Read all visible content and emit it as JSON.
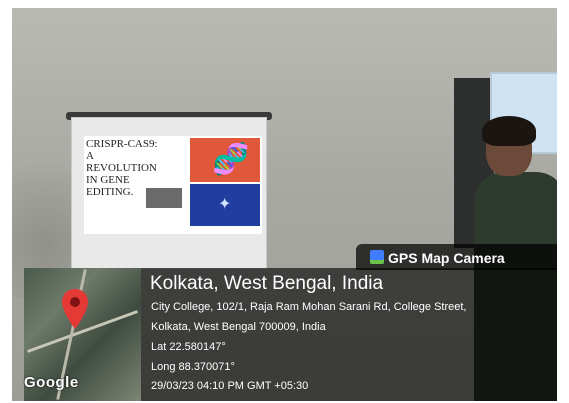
{
  "slide": {
    "title_lines": [
      "CRISPR-CAS9:",
      "A",
      "REVOLUTION",
      "IN GENE",
      "EDITING."
    ]
  },
  "overlay": {
    "app_name": "GPS Map Camera",
    "title": "Kolkata, West Bengal, India",
    "address_line1": "City College, 102/1, Raja Ram Mohan Sarani Rd, College Street,",
    "address_line2": "Kolkata, West Bengal 700009, India",
    "lat": "Lat 22.580147°",
    "long": "Long 88.370071°",
    "datetime": "29/03/23 04:10 PM GMT +05:30",
    "map_brand": "Google"
  },
  "icons": {
    "pin": "map-pin-icon",
    "app": "gps-camera-icon",
    "dna": "dna-icon"
  },
  "colors": {
    "pin": "#e53935",
    "slide_top": "#e0573a",
    "slide_bottom": "#1f3ea0"
  }
}
